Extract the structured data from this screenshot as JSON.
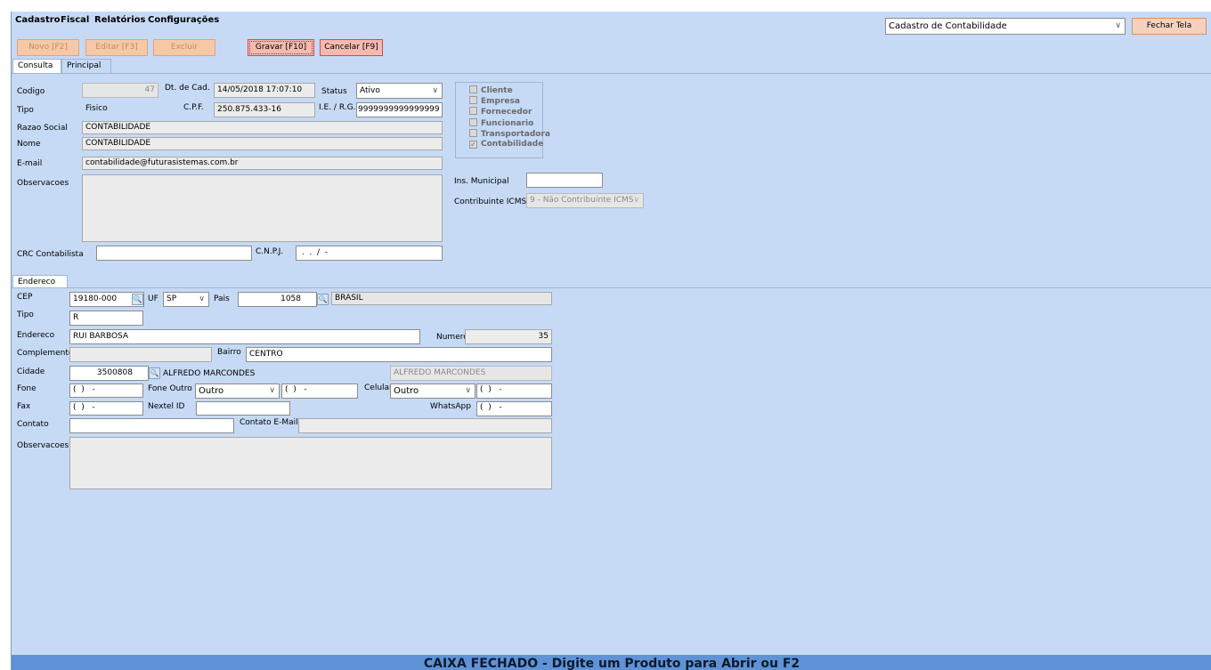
{
  "menu": [
    "Cadastro",
    "Fiscal",
    "Relatórios",
    "Configurações"
  ],
  "window_select": "Cadastro de Contabilidade",
  "close_label": "Fechar Tela",
  "toolbar": {
    "novo": "Novo [F2]",
    "editar": "Editar [F3]",
    "excluir": "Excluir",
    "gravar": "Gravar [F10]",
    "cancelar": "Cancelar [F9]"
  },
  "tabs": [
    "Consulta",
    "Principal"
  ],
  "form": {
    "codigo_label": "Codigo",
    "codigo": "47",
    "dtcad_label": "Dt. de Cad.",
    "dtcad": "14/05/2018 17:07:10",
    "status_label": "Status",
    "status": "Ativo",
    "tipo_label": "Tipo",
    "tipo": "Fisico",
    "cpf_label": "C.P.F.",
    "cpf": "250.875.433-16",
    "ie_label": "I.E. / R.G.",
    "ie": "9999999999999999",
    "razao_label": "Razao Social",
    "razao": "CONTABILIDADE",
    "nome_label": "Nome",
    "nome": "CONTABILIDADE",
    "email_label": "E-mail",
    "email": "contabilidade@futurasistemas.com.br",
    "obs_label": "Observacoes",
    "crc_label": "CRC Contabilista",
    "cnpj_label": "C.N.P.J.",
    "cnpj": " .  .  /  -",
    "ins_municipal_label": "Ins. Municipal",
    "icms_label": "Contribuinte ICMS",
    "icms": "9 - Não Contribuinte ICMS"
  },
  "roles": [
    {
      "label": "Cliente",
      "checked": false
    },
    {
      "label": "Empresa",
      "checked": false
    },
    {
      "label": "Fornecedor",
      "checked": false
    },
    {
      "label": "Funcionario",
      "checked": false
    },
    {
      "label": "Transportadora",
      "checked": false
    },
    {
      "label": "Contabilidade",
      "checked": true
    }
  ],
  "endereco_tab": "Endereco",
  "address": {
    "cep_label": "CEP",
    "cep": "19180-000",
    "uf_label": "UF",
    "uf": "SP",
    "pais_label": "Pais",
    "pais_code": "1058",
    "pais_name": "BRASIL",
    "tipo_label": "Tipo",
    "tipo": "R",
    "endereco_label": "Endereco",
    "endereco": "RUI BARBOSA",
    "numero_label": "Numero",
    "numero": "35",
    "complemento_label": "Complemento",
    "bairro_label": "Bairro",
    "bairro": "CENTRO",
    "cidade_label": "Cidade",
    "cidade_code": "3500808",
    "cidade_name": "ALFREDO MARCONDES",
    "cidade_name2": "ALFREDO MARCONDES",
    "fone_label": "Fone",
    "fone": "(  )   -",
    "fone_outro_label": "Fone Outro",
    "fone_outro_tipo": "Outro",
    "fone_outro": "(  )   -",
    "celular_label": "Celular",
    "celular_tipo": "Outro",
    "celular": "(  )   -",
    "fax_label": "Fax",
    "fax": "(  )   -",
    "nextel_label": "Nextel ID",
    "whatsapp_label": "WhatsApp",
    "whatsapp": "(  )   -",
    "contato_label": "Contato",
    "contato_email_label": "Contato E-Mail",
    "obs_label": "Observacoes"
  },
  "status_bar": "CAIXA FECHADO - Digite um Produto para Abrir ou F2"
}
